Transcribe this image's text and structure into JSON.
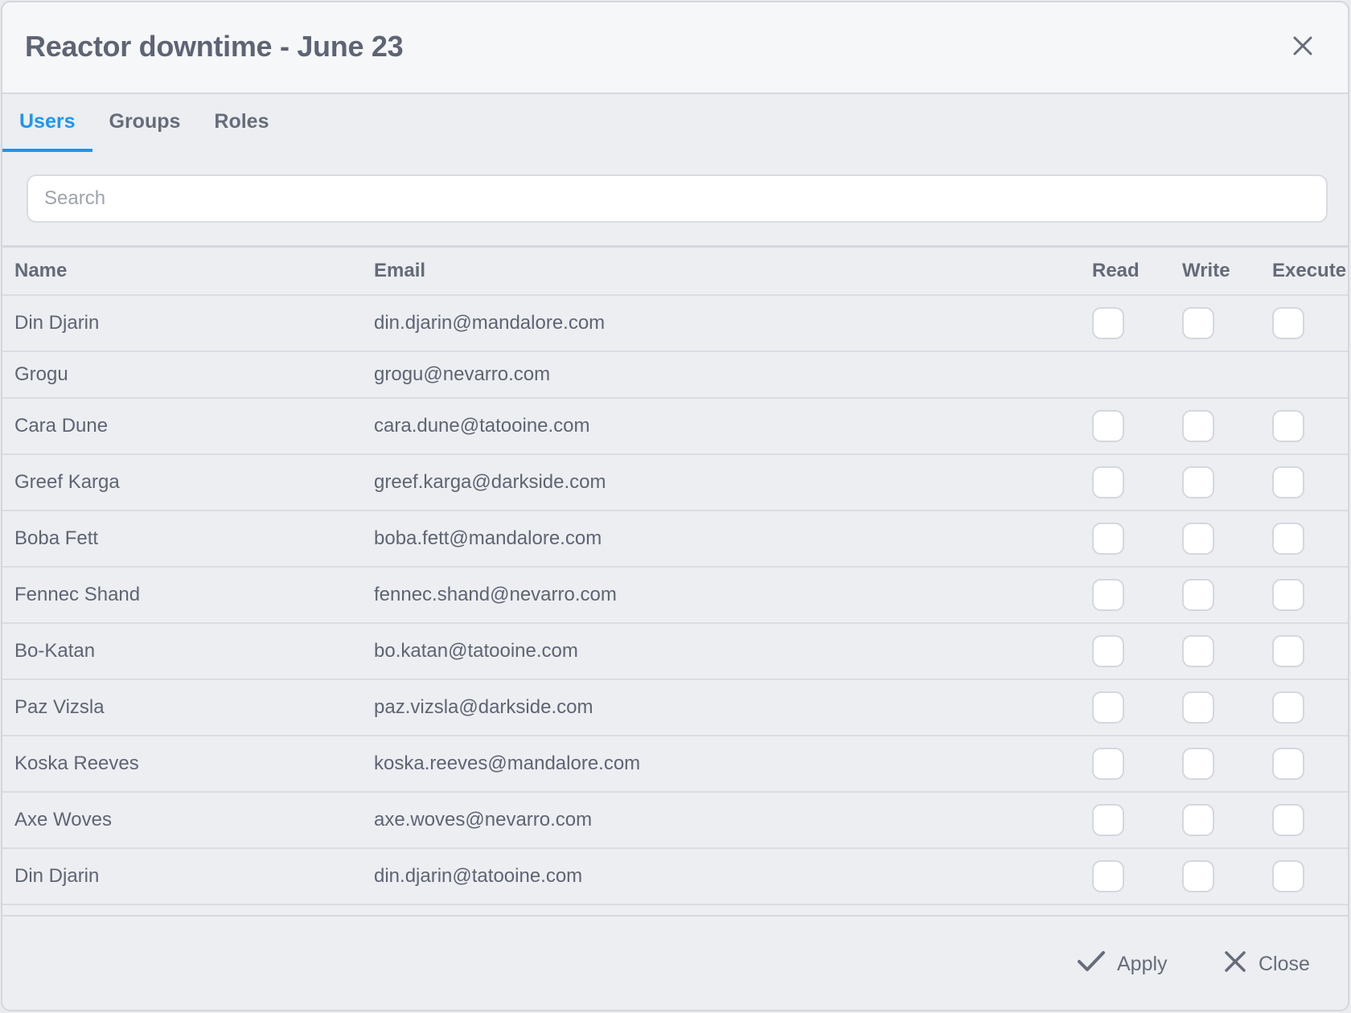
{
  "dialog": {
    "title": "Reactor downtime - June 23"
  },
  "tabs": [
    {
      "label": "Users",
      "active": true
    },
    {
      "label": "Groups",
      "active": false
    },
    {
      "label": "Roles",
      "active": false
    }
  ],
  "search": {
    "placeholder": "Search",
    "value": ""
  },
  "table": {
    "headers": {
      "name": "Name",
      "email": "Email",
      "read": "Read",
      "write": "Write",
      "execute": "Execute"
    },
    "rows": [
      {
        "name": "Din Djarin",
        "email": "din.djarin@mandalore.com",
        "has_permissions": true,
        "read": false,
        "write": false,
        "execute": false
      },
      {
        "name": "Grogu",
        "email": "grogu@nevarro.com",
        "has_permissions": false
      },
      {
        "name": "Cara Dune",
        "email": "cara.dune@tatooine.com",
        "has_permissions": true,
        "read": false,
        "write": false,
        "execute": false
      },
      {
        "name": "Greef Karga",
        "email": "greef.karga@darkside.com",
        "has_permissions": true,
        "read": false,
        "write": false,
        "execute": false
      },
      {
        "name": "Boba Fett",
        "email": "boba.fett@mandalore.com",
        "has_permissions": true,
        "read": false,
        "write": false,
        "execute": false
      },
      {
        "name": "Fennec Shand",
        "email": "fennec.shand@nevarro.com",
        "has_permissions": true,
        "read": false,
        "write": false,
        "execute": false
      },
      {
        "name": "Bo-Katan",
        "email": "bo.katan@tatooine.com",
        "has_permissions": true,
        "read": false,
        "write": false,
        "execute": false
      },
      {
        "name": "Paz Vizsla",
        "email": "paz.vizsla@darkside.com",
        "has_permissions": true,
        "read": false,
        "write": false,
        "execute": false
      },
      {
        "name": "Koska Reeves",
        "email": "koska.reeves@mandalore.com",
        "has_permissions": true,
        "read": false,
        "write": false,
        "execute": false
      },
      {
        "name": "Axe Woves",
        "email": "axe.woves@nevarro.com",
        "has_permissions": true,
        "read": false,
        "write": false,
        "execute": false
      },
      {
        "name": "Din Djarin",
        "email": "din.djarin@tatooine.com",
        "has_permissions": true,
        "read": false,
        "write": false,
        "execute": false
      }
    ]
  },
  "footer": {
    "apply_label": "Apply",
    "close_label": "Close"
  },
  "icons": {
    "close": "close-icon",
    "apply": "check-icon",
    "footer_close": "close-icon"
  },
  "colors": {
    "accent": "#1e96f0",
    "text": "#5f6473",
    "background": "#eceef2"
  }
}
